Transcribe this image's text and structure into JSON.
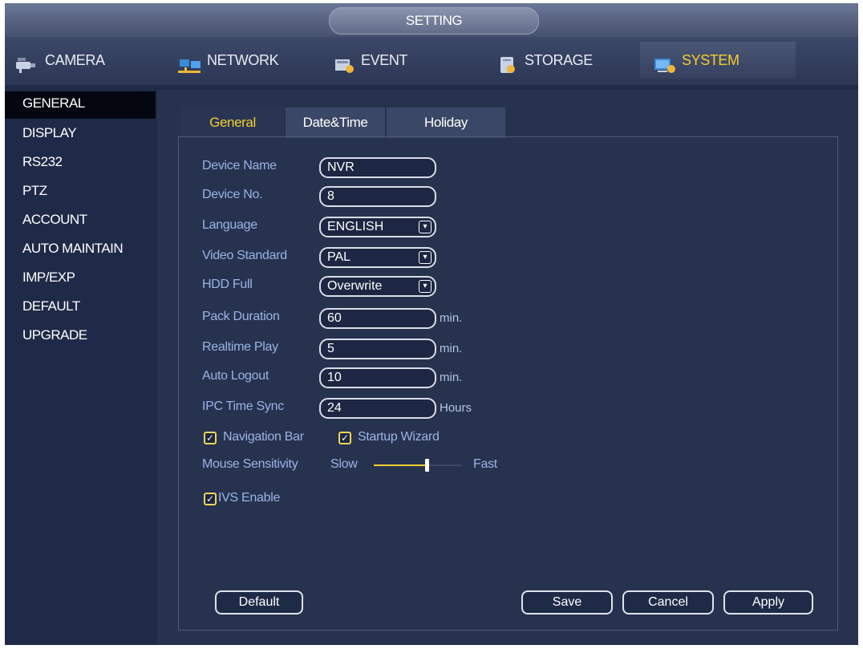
{
  "window": {
    "title": "SETTING"
  },
  "main_tabs": [
    {
      "label": "CAMERA",
      "icon": "camera-icon"
    },
    {
      "label": "NETWORK",
      "icon": "network-icon"
    },
    {
      "label": "EVENT",
      "icon": "event-icon"
    },
    {
      "label": "STORAGE",
      "icon": "storage-icon"
    },
    {
      "label": "SYSTEM",
      "icon": "system-icon",
      "active": true
    }
  ],
  "sidebar": {
    "items": [
      {
        "label": "GENERAL",
        "active": true
      },
      {
        "label": "DISPLAY"
      },
      {
        "label": "RS232"
      },
      {
        "label": "PTZ"
      },
      {
        "label": "ACCOUNT"
      },
      {
        "label": "AUTO MAINTAIN"
      },
      {
        "label": "IMP/EXP"
      },
      {
        "label": "DEFAULT"
      },
      {
        "label": "UPGRADE"
      }
    ]
  },
  "sub_tabs": [
    {
      "label": "General",
      "active": true
    },
    {
      "label": "Date&Time"
    },
    {
      "label": "Holiday"
    }
  ],
  "form": {
    "device_name": {
      "label": "Device Name",
      "value": "NVR"
    },
    "device_no": {
      "label": "Device No.",
      "value": "8"
    },
    "language": {
      "label": "Language",
      "value": "ENGLISH"
    },
    "video_standard": {
      "label": "Video Standard",
      "value": "PAL"
    },
    "hdd_full": {
      "label": "HDD Full",
      "value": "Overwrite"
    },
    "pack_duration": {
      "label": "Pack Duration",
      "value": "60",
      "unit": "min."
    },
    "realtime_play": {
      "label": "Realtime Play",
      "value": "5",
      "unit": "min."
    },
    "auto_logout": {
      "label": "Auto Logout",
      "value": "10",
      "unit": "min."
    },
    "ipc_time_sync": {
      "label": "IPC Time Sync",
      "value": "24",
      "unit": "Hours"
    },
    "navigation_bar": {
      "label": "Navigation Bar",
      "checked": true
    },
    "startup_wizard": {
      "label": "Startup Wizard",
      "checked": true
    },
    "mouse_sensitivity": {
      "label": "Mouse Sensitivity",
      "slow": "Slow",
      "fast": "Fast",
      "level": 0.6
    },
    "ivs_enable": {
      "label": "IVS Enable",
      "checked": true
    }
  },
  "buttons": {
    "default": "Default",
    "save": "Save",
    "cancel": "Cancel",
    "apply": "Apply"
  },
  "colors": {
    "accent": "#f2cf2c",
    "label": "#9ab4e6",
    "background": "#1f2a48"
  }
}
